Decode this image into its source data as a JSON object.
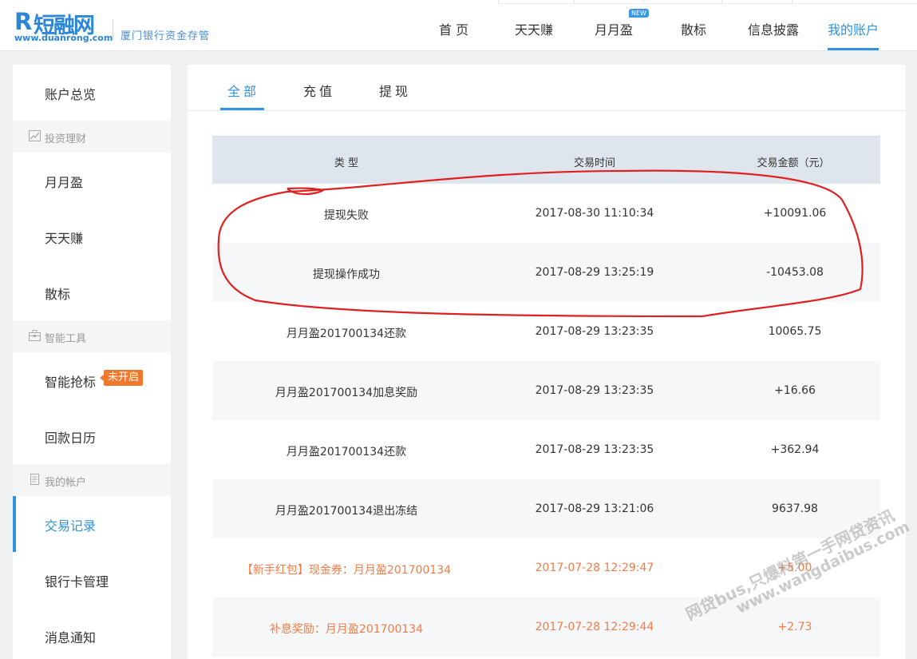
{
  "header": {
    "logo_mark": "R",
    "logo_text": "短融网",
    "logo_url": "www.duanrong.com",
    "slogan": "厦门银行资金存管",
    "nav": [
      {
        "label": "首 页"
      },
      {
        "label": "天天赚"
      },
      {
        "label": "月月盈",
        "badge": "NEW"
      },
      {
        "label": "散标"
      },
      {
        "label": "信息披露"
      },
      {
        "label": "我的账户",
        "active": true
      }
    ]
  },
  "sidebar": {
    "overview": "账户总览",
    "groups": {
      "invest": {
        "label": "投资理财",
        "icon": "chart-icon"
      },
      "tools": {
        "label": "智能工具",
        "icon": "briefcase-icon"
      },
      "account": {
        "label": "我的帐户",
        "icon": "document-icon"
      }
    },
    "items": {
      "yueyueying": "月月盈",
      "tiantianzhuan": "天天赚",
      "sanbiao": "散标",
      "smart_bid": "智能抢标",
      "smart_bid_tag": "未开启",
      "repay_calendar": "回款日历",
      "transactions": "交易记录",
      "bank_cards": "银行卡管理",
      "messages": "消息通知"
    },
    "active": "交易记录"
  },
  "tabs": [
    {
      "label": "全部",
      "active": true
    },
    {
      "label": "充值"
    },
    {
      "label": "提现"
    }
  ],
  "table": {
    "headers": [
      "类 型",
      "交易时间",
      "交易金额（元）"
    ],
    "rows": [
      {
        "type": "提现失败",
        "time": "2017-08-30 11:10:34",
        "amount": "+10091.06"
      },
      {
        "type": "提现操作成功",
        "time": "2017-08-29 13:25:19",
        "amount": "-10453.08"
      },
      {
        "type": "月月盈201700134还款",
        "time": "2017-08-29 13:23:35",
        "amount": "10065.75"
      },
      {
        "type": "月月盈201700134加息奖励",
        "time": "2017-08-29 13:23:35",
        "amount": "+16.66"
      },
      {
        "type": "月月盈201700134还款",
        "time": "2017-08-29 13:23:35",
        "amount": "+362.94"
      },
      {
        "type": "月月盈201700134退出冻结",
        "time": "2017-08-29 13:21:06",
        "amount": "9637.98"
      },
      {
        "type": "【新手红包】现金券：月月盈201700134",
        "time": "2017-07-28 12:29:47",
        "amount": "+5.00",
        "highlight": true
      },
      {
        "type": "补息奖励：月月盈201700134",
        "time": "2017-07-28 12:29:44",
        "amount": "+2.73",
        "highlight": true
      }
    ]
  },
  "watermark": {
    "line1": "网贷bus,只爆料第一手网贷资讯",
    "line2": "www.wangdaibus.com"
  },
  "colors": {
    "accent": "#2f93df",
    "highlight": "#f07c49",
    "annotation": "#e02020"
  }
}
